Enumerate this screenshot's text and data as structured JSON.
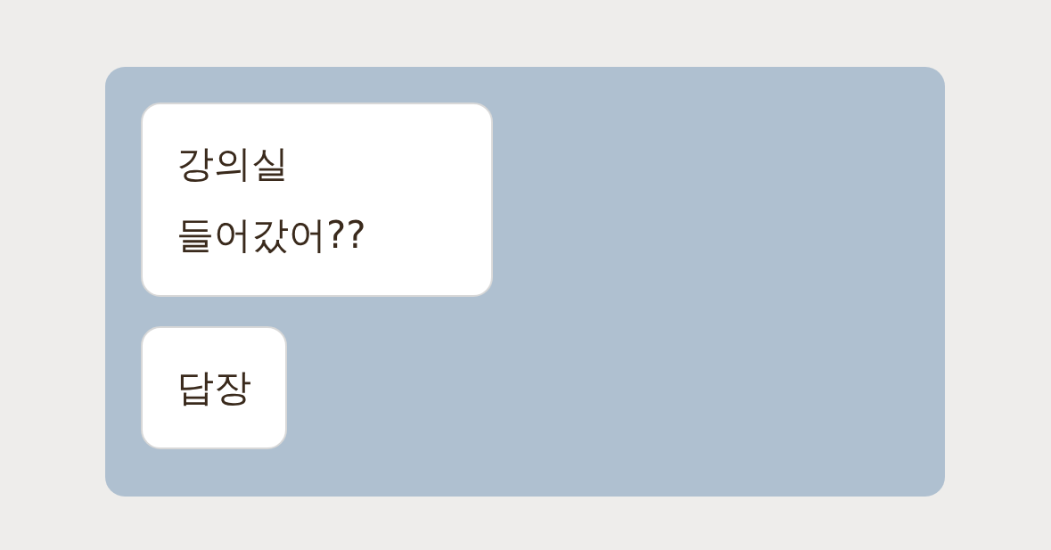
{
  "messages": [
    {
      "text": "강의실\n들어갔어??"
    },
    {
      "text": "답장"
    }
  ]
}
